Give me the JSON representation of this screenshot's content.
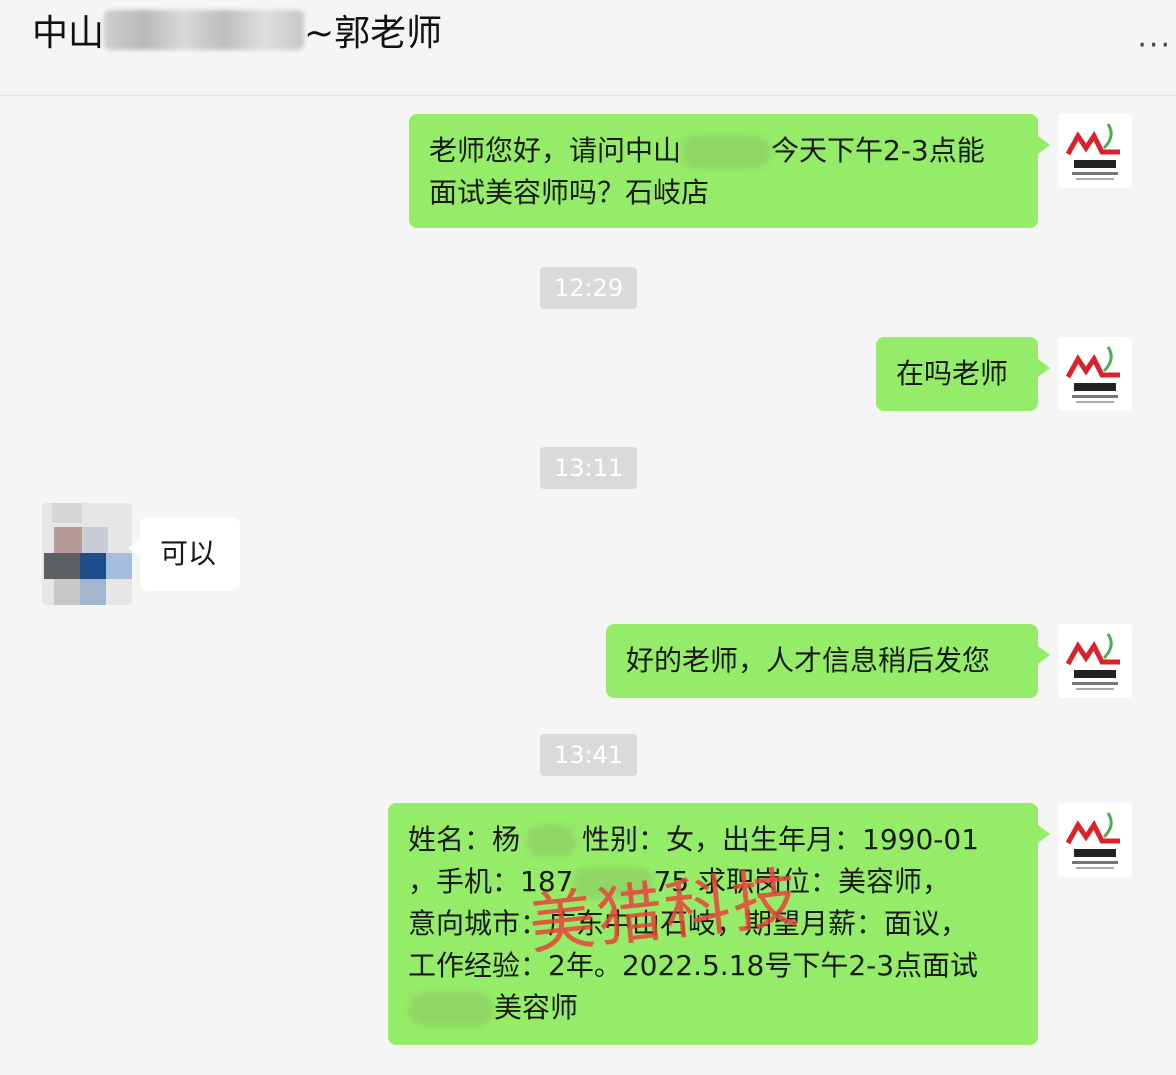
{
  "header": {
    "title_prefix": "中山",
    "title_suffix": "~郭老师",
    "more_label": "···"
  },
  "messages": {
    "m1": {
      "line1_a": "老师您好，请问中山",
      "line1_b": "今天下午2-3点能",
      "line2": "面试美容师吗？石岐店"
    },
    "t1": "12:29",
    "m2": "在吗老师",
    "t2": "13:11",
    "m3": "可以",
    "m4": "好的老师，人才信息稍后发您",
    "t3": "13:41",
    "m5": {
      "l1_a": "姓名：杨",
      "l1_b": "性别：女，出生年月：1990-01",
      "l2_a": "，手机：187",
      "l2_b": "75",
      "l2_c": "求职岗位：美容师，",
      "l3": "意向城市：广东中山石岐，期望月薪：面议，",
      "l4": "工作经验：2年。2022.5.18号下午2-3点面试",
      "l5": "美容师"
    }
  },
  "watermark": "美猎科技",
  "colors": {
    "bubble_out": "#95ec69",
    "bubble_in": "#ffffff",
    "time_bg": "#dadada",
    "watermark": "#e8443a"
  }
}
